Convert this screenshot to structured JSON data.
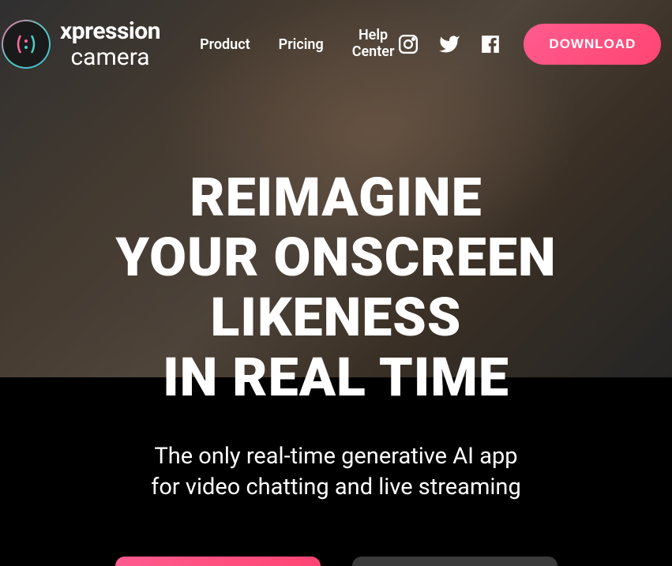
{
  "brand": {
    "line1": "xpression",
    "line2": "camera"
  },
  "nav": {
    "product": "Product",
    "pricing": "Pricing",
    "help_center_line1": "Help",
    "help_center_line2": "Center",
    "download": "DOWNLOAD"
  },
  "hero": {
    "title_line1": "REIMAGINE",
    "title_line2": "YOUR ONSCREEN",
    "title_line3": "LIKENESS",
    "title_line4": "IN REAL TIME",
    "subtitle_line1": "The only real-time generative AI app",
    "subtitle_line2": "for video chatting and live streaming"
  },
  "icons": {
    "instagram": "instagram-icon",
    "twitter": "twitter-icon",
    "facebook": "facebook-icon"
  }
}
